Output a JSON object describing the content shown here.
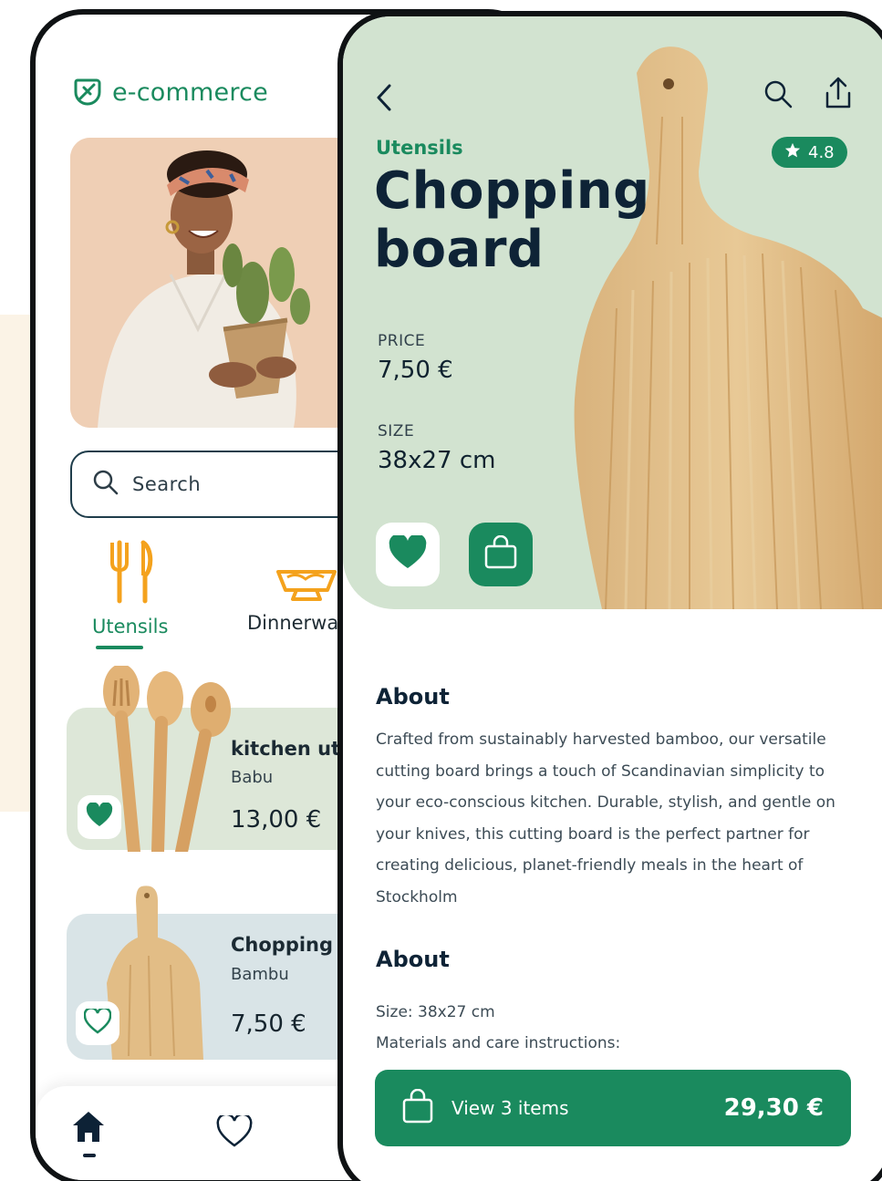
{
  "brand": {
    "name": "e-commerce",
    "accent": "#1a8a5e"
  },
  "search": {
    "placeholder": "Search"
  },
  "categories": [
    {
      "label": "Utensils",
      "icon": "utensils-icon",
      "active": true
    },
    {
      "label": "Dinnerwa",
      "icon": "bowl-icon",
      "active": false
    }
  ],
  "products": [
    {
      "title": "kitchen ute",
      "brand": "Babu",
      "price": "13,00 €",
      "favorited": true
    },
    {
      "title": "Chopping b",
      "brand": "Bambu",
      "price": "7,50 €",
      "favorited": false
    }
  ],
  "tabbar": {
    "items": [
      "home-icon",
      "heart-icon"
    ]
  },
  "detail": {
    "category": "Utensils",
    "title": "Chopping board",
    "rating": "4.8",
    "price_label": "PRICE",
    "price": "7,50 €",
    "size_label": "SIZE",
    "size": "38x27 cm",
    "about_title": "About",
    "about_text": "Crafted from sustainably harvested bamboo, our versatile cutting board brings a touch of Scandinavian simplicity to your eco-conscious kitchen. Durable, stylish, and gentle on your knives, this cutting board is the perfect partner for creating delicious, planet-friendly meals in the heart of Stockholm",
    "details_title": "About",
    "size_line": "Size: 38x27 cm",
    "materials_line": "Materials and care instructions:",
    "cart_label": "View 3 items",
    "cart_total": "29,30 €"
  }
}
